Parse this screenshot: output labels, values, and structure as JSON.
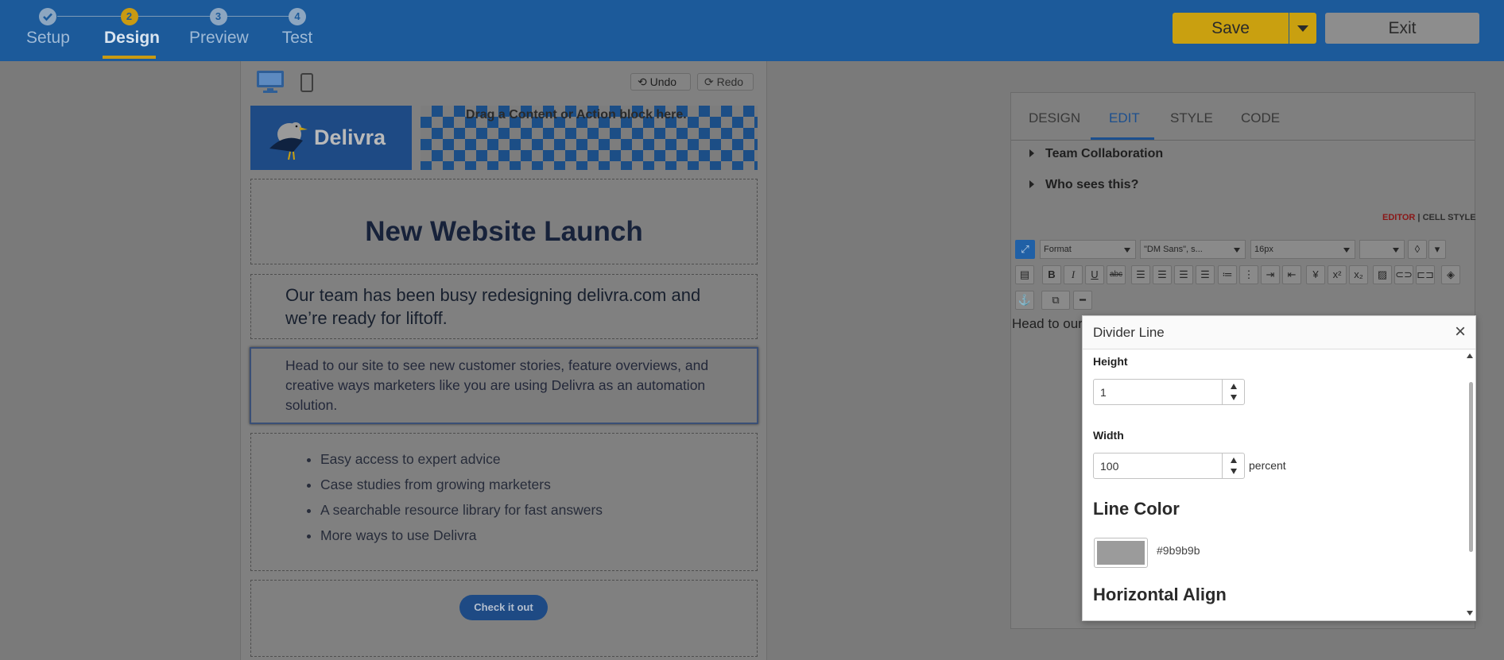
{
  "steps": [
    {
      "number": "",
      "label": "Setup",
      "state": "done"
    },
    {
      "number": "2",
      "label": "Design",
      "state": "active"
    },
    {
      "number": "3",
      "label": "Preview",
      "state": "todo"
    },
    {
      "number": "4",
      "label": "Test",
      "state": "todo"
    }
  ],
  "header": {
    "save_label": "Save",
    "exit_label": "Exit"
  },
  "canvas": {
    "undo_label": "Undo",
    "redo_label": "Redo",
    "logo_text": "Delivra",
    "drop_hint": "Drag a Content or Action block here.",
    "headline": "New Website Launch",
    "intro": "Our team has been busy redesigning delivra.com and we’re ready for liftoff.",
    "body": "Head to our site to see new customer stories, feature overviews, and creative ways marketers like you are using Delivra as an automation solution.",
    "bullets": [
      "Easy access to expert advice",
      "Case studies from growing marketers",
      "A searchable resource library for fast answers",
      "More ways to use Delivra"
    ],
    "cta_label": "Check it out"
  },
  "panel": {
    "tabs": [
      "DESIGN",
      "EDIT",
      "STYLE",
      "CODE"
    ],
    "active_tab": "EDIT",
    "accordions": [
      "Team Collaboration",
      "Who sees this?"
    ],
    "editor_link": "EDITOR",
    "cell_style_link": "CELL STYLE",
    "toolbar": {
      "format": "Format",
      "font": "\"DM Sans\", s...",
      "size": "16px",
      "blank": ""
    },
    "editor_preview": "Head to our site to see new customer stories, feature overviews, and creative ways marketers like you are using Delivra as an automation solution."
  },
  "modal": {
    "title": "Divider Line",
    "close_label": "×",
    "height_label": "Height",
    "height_value": "1",
    "width_label": "Width",
    "width_value": "100",
    "width_unit": "percent",
    "line_color_label": "Line Color",
    "line_color_hex": "#9b9b9b",
    "h_align_label": "Horizontal Align"
  },
  "colors": {
    "brand_blue": "#1c5a9a",
    "accent_gold": "#c99a12",
    "line_color": "#9b9b9b"
  }
}
